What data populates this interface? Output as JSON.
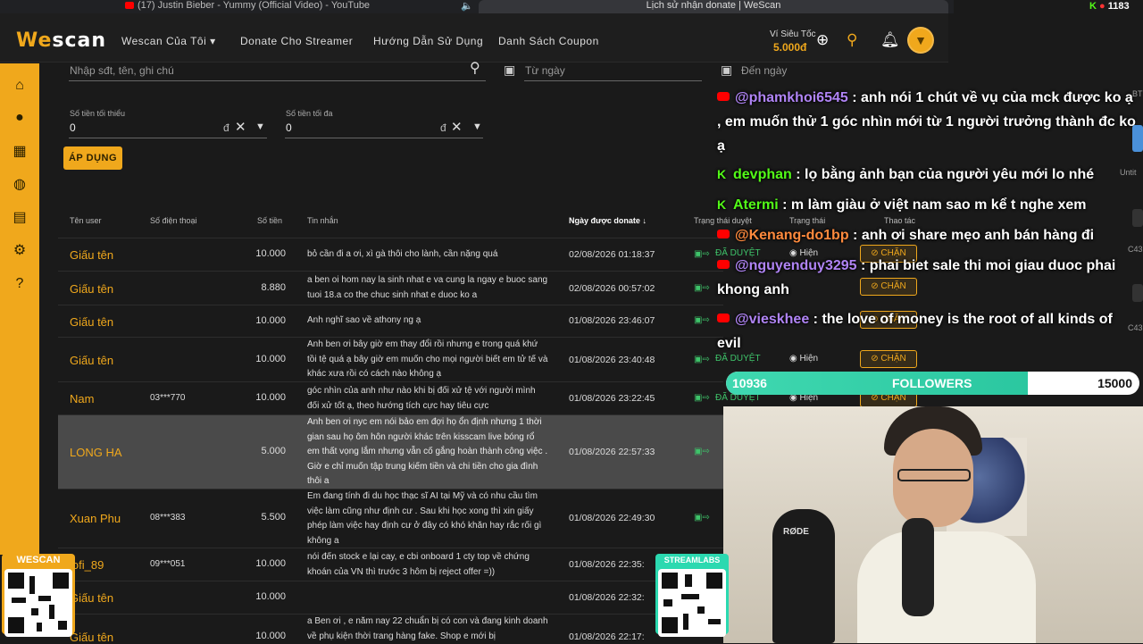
{
  "browser": {
    "tab1": "(17) Justin Bieber - Yummy (Official Video) - YouTube",
    "tab2": "Lịch sử nhận donate | WeScan"
  },
  "stream_stats": {
    "kick_viewers": "1183"
  },
  "header": {
    "logo_a": "We",
    "logo_b": "scan",
    "nav": [
      "Wescan Của Tôi",
      "Donate Cho Streamer",
      "Hướng Dẫn Sử Dụng",
      "Danh Sách Coupon"
    ],
    "wallet_label": "Ví Siêu Tốc",
    "wallet_value": "5.000đ"
  },
  "filters": {
    "search_placeholder": "Nhập sđt, tên, ghi chú",
    "from_placeholder": "Từ ngày",
    "to_placeholder": "Đến ngày",
    "min_label": "Số tiền tối thiểu",
    "min_value": "0",
    "max_label": "Số tiền tối đa",
    "max_value": "0",
    "currency": "đ",
    "apply": "ÁP DỤNG"
  },
  "table": {
    "headers": {
      "user": "Tên user",
      "phone": "Số điện thoại",
      "amount": "Số tiền",
      "message": "Tin nhắn",
      "date": "Ngày được donate",
      "approval": "Trạng thái duyệt",
      "status": "Trạng thái",
      "action": "Thao tác"
    },
    "rows": [
      {
        "name": "Giấu tên",
        "phone": "",
        "amount": "10.000",
        "message": "bỏ cần đi a ơi, xì gà thôi cho lành, cần nặng quá",
        "date": "02/08/2026 01:18:37",
        "status": "ĐÃ DUYỆT"
      },
      {
        "name": "Giấu tên",
        "phone": "",
        "amount": "8.880",
        "message": "a ben oi hom nay la sinh nhat e va cung la ngay e buoc sang tuoi 18.a co the chuc sinh nhat e duoc ko a",
        "date": "02/08/2026 00:57:02",
        "status": "ĐÃ DUYỆT"
      },
      {
        "name": "Giấu tên",
        "phone": "",
        "amount": "10.000",
        "message": "Anh nghĩ sao về athony ng ạ",
        "date": "01/08/2026 23:46:07",
        "status": "ĐÃ DUYỆT"
      },
      {
        "name": "Giấu tên",
        "phone": "",
        "amount": "10.000",
        "message": "Anh ben ơi bây giờ em thay đổi rồi nhưng e trong quá khứ tồi tệ quá ạ bây giờ em muốn cho mọi người biết em tử tế và khác xưa rồi có cách nào không ạ",
        "date": "01/08/2026 23:40:48",
        "status": "ĐÃ DUYỆT"
      },
      {
        "name": "Nam",
        "phone": "03***770",
        "amount": "10.000",
        "message": "góc nhìn của anh như nào khi bị đối xử tệ với người mình đối xử tốt ạ, theo hướng tích cực hay tiêu cực",
        "date": "01/08/2026 23:22:45",
        "status": "ĐÃ DUYỆT"
      },
      {
        "name": "LONG HA",
        "phone": "",
        "amount": "5.000",
        "message": "Anh ben ơi nyc em nói bảo em đợi họ ổn định nhưng 1 thời gian sau họ ôm hôn người khác trên kisscam live bóng rổ em thất vọng lắm nhưng vẫn cố gắng hoàn thành công việc . Giờ e chỉ muốn tập trung kiếm tiền và chi tiền cho gia đình thôi a",
        "date": "01/08/2026 22:57:33",
        "status": "ĐÃ"
      },
      {
        "name": "Xuan Phu",
        "phone": "08***383",
        "amount": "5.500",
        "message": "Em đang tính đi du học thạc sĩ AI tại Mỹ và có nhu cầu tìm việc làm cũng như định cư . Sau khi học xong thì xin giấy phép làm việc hay định cư ở đây có khó khăn hay rắc rối gì không a",
        "date": "01/08/2026 22:49:30",
        "status": "ĐÃ"
      },
      {
        "name": "lofi_89",
        "phone": "09***051",
        "amount": "10.000",
        "message": "nói đến stock e lại cay, e cbi onboard 1 cty top về chứng khoán của VN thì trước 3 hôm bị reject offer =))",
        "date": "01/08/2026 22:35:",
        "status": "ĐÃ"
      },
      {
        "name": "Giấu tên",
        "phone": "",
        "amount": "10.000",
        "message": "",
        "date": "01/08/2026 22:32:",
        "status": ""
      },
      {
        "name": "Giấu tên",
        "phone": "",
        "amount": "10.000",
        "message": "a Ben ơi , e năm nay 22 chuẩn bị có con và đang kinh doanh về phụ kiện thời trang hàng fake. Shop e mới bị",
        "date": "01/08/2026 22:17:",
        "status": ""
      }
    ],
    "show_label": "Hiện",
    "block_label": "CHẶN"
  },
  "chat": [
    {
      "platform": "youtube",
      "user": "@phamkhoi6545",
      "text": ": anh nói 1 chút về vụ của mck được ko ạ , em muốn thử 1 góc nhìn mới từ 1 người trưởng thành đc ko ạ"
    },
    {
      "platform": "kick",
      "user": "devphan",
      "text": ": lọ bằng ảnh bạn của người yêu mới lo nhé"
    },
    {
      "platform": "kick",
      "user": "Atermi",
      "text": ": m làm giàu ở việt nam sao m kể t nghe xem"
    },
    {
      "platform": "youtube",
      "user": "@Kenang-do1bp",
      "text": ": anh ơi share mẹo anh bán hàng đi"
    },
    {
      "platform": "youtube",
      "user": "@nguyenduy3295",
      "text": ": phai biet sale thi moi giau duoc phai khong anh"
    },
    {
      "platform": "youtube",
      "user": "@vieskhee",
      "text": ": the love of money is the root of all kinds of evil"
    }
  ],
  "followers": {
    "current": "10936",
    "label": "FOLLOWERS",
    "goal": "15000",
    "progress": 0.729
  },
  "widgets": {
    "qr_left": "WESCAN",
    "qr_right": "STREAMLABS",
    "mic_brand": "RØDE"
  },
  "colors": {
    "accent": "#f0a81c",
    "approved": "#3ec46a",
    "youtube_user": "#b084f5",
    "kick": "#53fc18"
  }
}
